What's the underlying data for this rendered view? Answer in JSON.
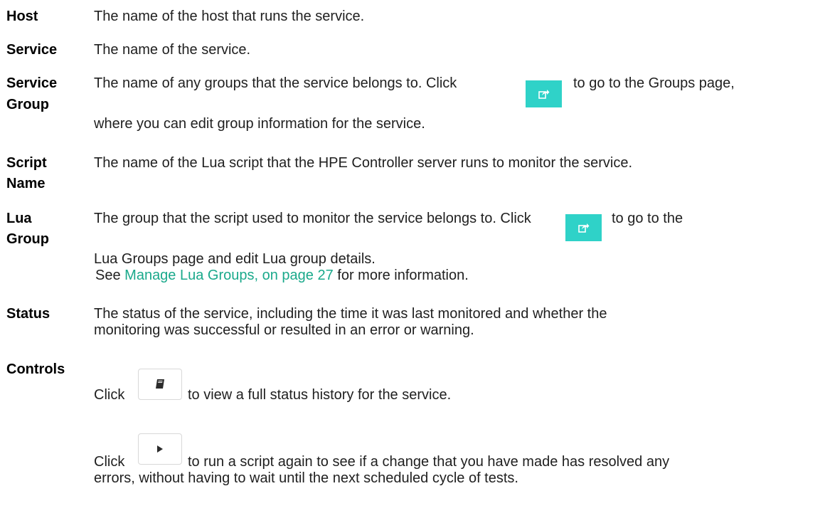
{
  "rows": {
    "host": {
      "term": "Host",
      "desc": "The name of the host that runs the service."
    },
    "service": {
      "term": "Service",
      "desc": "The name of the service."
    },
    "service_group": {
      "term_line1": "Service",
      "term_line2": "Group",
      "desc_before": "The name of any groups that the service belongs to. Click",
      "desc_after": "to go to the Groups page,",
      "desc_line2": "where you can edit group information for the service."
    },
    "script_name": {
      "term_line1": "Script",
      "term_line2": "Name",
      "desc": "The name of the Lua script that the HPE Controller server runs to monitor the service."
    },
    "lua_group": {
      "term_line1": "Lua",
      "term_line2": "Group",
      "desc_before": "The group that the script used to monitor the service belongs to. Click",
      "desc_after": "to go to the",
      "desc_line2": "Lua Groups page and edit Lua group details.",
      "see_prefix": "See",
      "see_link": "Manage Lua Groups, on page 27",
      "see_suffix": "for more information."
    },
    "status": {
      "term": "Status",
      "desc_line1": "The status of the service, including the time it was last monitored and whether the",
      "desc_line2": "monitoring was successful or resulted in an error or warning."
    },
    "controls": {
      "term": "Controls",
      "history_before": "Click",
      "history_after": "to view a full status history for the service.",
      "run_before": "Click",
      "run_after": "to run a script again to see if a change that you have made has resolved any",
      "run_line2": "errors, without having to wait until the next scheduled cycle of tests."
    }
  },
  "icons": {
    "edit_link": "external-link-icon",
    "history": "book-icon",
    "run": "play-icon"
  },
  "colors": {
    "link": "#1aa98b",
    "teal_button": "#2fd2c8"
  }
}
